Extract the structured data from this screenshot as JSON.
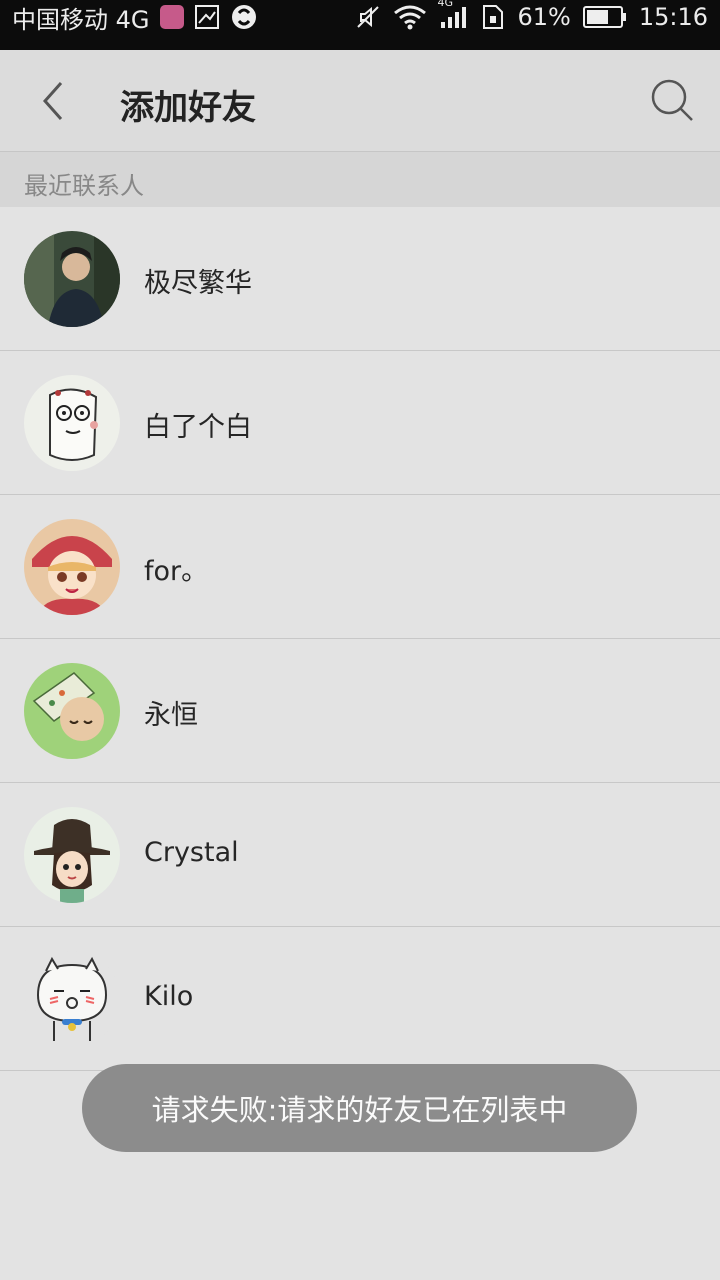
{
  "status_bar": {
    "carrier": "中国移动 4G",
    "network_badge": "4G",
    "battery": "61%",
    "time": "15:16",
    "icons": [
      "app-notification-icon",
      "image-icon",
      "sync-icon",
      "mute-icon",
      "wifi-icon",
      "signal-icon",
      "sim-icon",
      "battery-icon"
    ]
  },
  "header": {
    "title": "添加好友",
    "back_icon": "chevron-left-icon",
    "search_icon": "search-icon"
  },
  "section": {
    "label": "最近联系人"
  },
  "contacts": [
    {
      "name": "极尽繁华",
      "avatar_colors": [
        "#2b3b2c",
        "#4a5a48"
      ]
    },
    {
      "name": "白了个白",
      "avatar_colors": [
        "#eef0ea",
        "#d9ddd4"
      ]
    },
    {
      "name": "for。",
      "avatar_colors": [
        "#c9474d",
        "#f2c9a0"
      ]
    },
    {
      "name": "永恒",
      "avatar_colors": [
        "#9fd27a",
        "#e8c9a5"
      ]
    },
    {
      "name": "Crystal",
      "avatar_colors": [
        "#e9efe6",
        "#3d3026"
      ]
    },
    {
      "name": "Kilo",
      "avatar_colors": [
        "#f1f1ef",
        "#3a7fd0"
      ]
    }
  ],
  "toast": {
    "text": "请求失败:请求的好友已在列表中"
  },
  "colors": {
    "background": "#e3e3e3",
    "header_bg": "#dcdcdc",
    "section_bg": "#d6d6d6",
    "toast_bg": "#8c8c8c",
    "status_bar_bg": "#0c0c0c"
  }
}
